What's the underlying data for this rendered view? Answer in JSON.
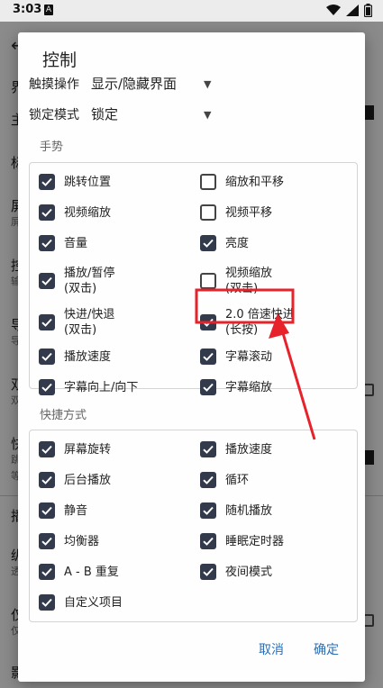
{
  "status_bar": {
    "time": "3:03",
    "notification_icon": "A",
    "icons": [
      "wifi-icon",
      "signal-icon",
      "battery-icon"
    ]
  },
  "background": {
    "rows": [
      "界",
      "主",
      "标",
      "屏",
      "屏",
      "控",
      "输",
      "导",
      "导",
      "双",
      "双",
      "快",
      "跳",
      "等",
      "播",
      "纵",
      "透",
      "仅",
      "仅",
      "影"
    ]
  },
  "dialog": {
    "title": "控制",
    "dropdowns": [
      {
        "label": "触摸操作",
        "value": "显示/隐藏界面"
      },
      {
        "label": "锁定模式",
        "value": "锁定"
      }
    ],
    "gestures": {
      "title": "手势",
      "items": [
        {
          "label": "跳转位置",
          "checked": true
        },
        {
          "label": "缩放和平移",
          "checked": false
        },
        {
          "label": "视频缩放",
          "checked": true
        },
        {
          "label": "视频平移",
          "checked": false
        },
        {
          "label": "音量",
          "checked": true
        },
        {
          "label": "亮度",
          "checked": true
        },
        {
          "label": "播放/暂停",
          "sub": "(双击)",
          "checked": true
        },
        {
          "label": "视频缩放",
          "sub": "(双击)",
          "checked": false
        },
        {
          "label": "快进/快退",
          "sub": "(双击)",
          "checked": true
        },
        {
          "label": "2.0 倍速快进",
          "sub": "(长按)",
          "checked": true
        },
        {
          "label": "播放速度",
          "checked": true
        },
        {
          "label": "字幕滚动",
          "checked": true
        },
        {
          "label": "字幕向上/向下",
          "checked": true
        },
        {
          "label": "字幕缩放",
          "checked": true
        }
      ]
    },
    "shortcuts": {
      "title": "快捷方式",
      "items": [
        {
          "label": "屏幕旋转",
          "checked": true
        },
        {
          "label": "播放速度",
          "checked": true
        },
        {
          "label": "后台播放",
          "checked": true
        },
        {
          "label": "循环",
          "checked": true
        },
        {
          "label": "静音",
          "checked": true
        },
        {
          "label": "随机播放",
          "checked": true
        },
        {
          "label": "均衡器",
          "checked": true
        },
        {
          "label": "睡眠定时器",
          "checked": true
        },
        {
          "label": "A - B 重复",
          "checked": true
        },
        {
          "label": "夜间模式",
          "checked": true
        },
        {
          "label": "自定义项目",
          "checked": true
        }
      ]
    },
    "buttons": {
      "cancel": "取消",
      "ok": "确定"
    }
  },
  "colors": {
    "accent": "#2d6fb4",
    "checkbox": "#333a4c",
    "annotation": "#e8222a"
  }
}
